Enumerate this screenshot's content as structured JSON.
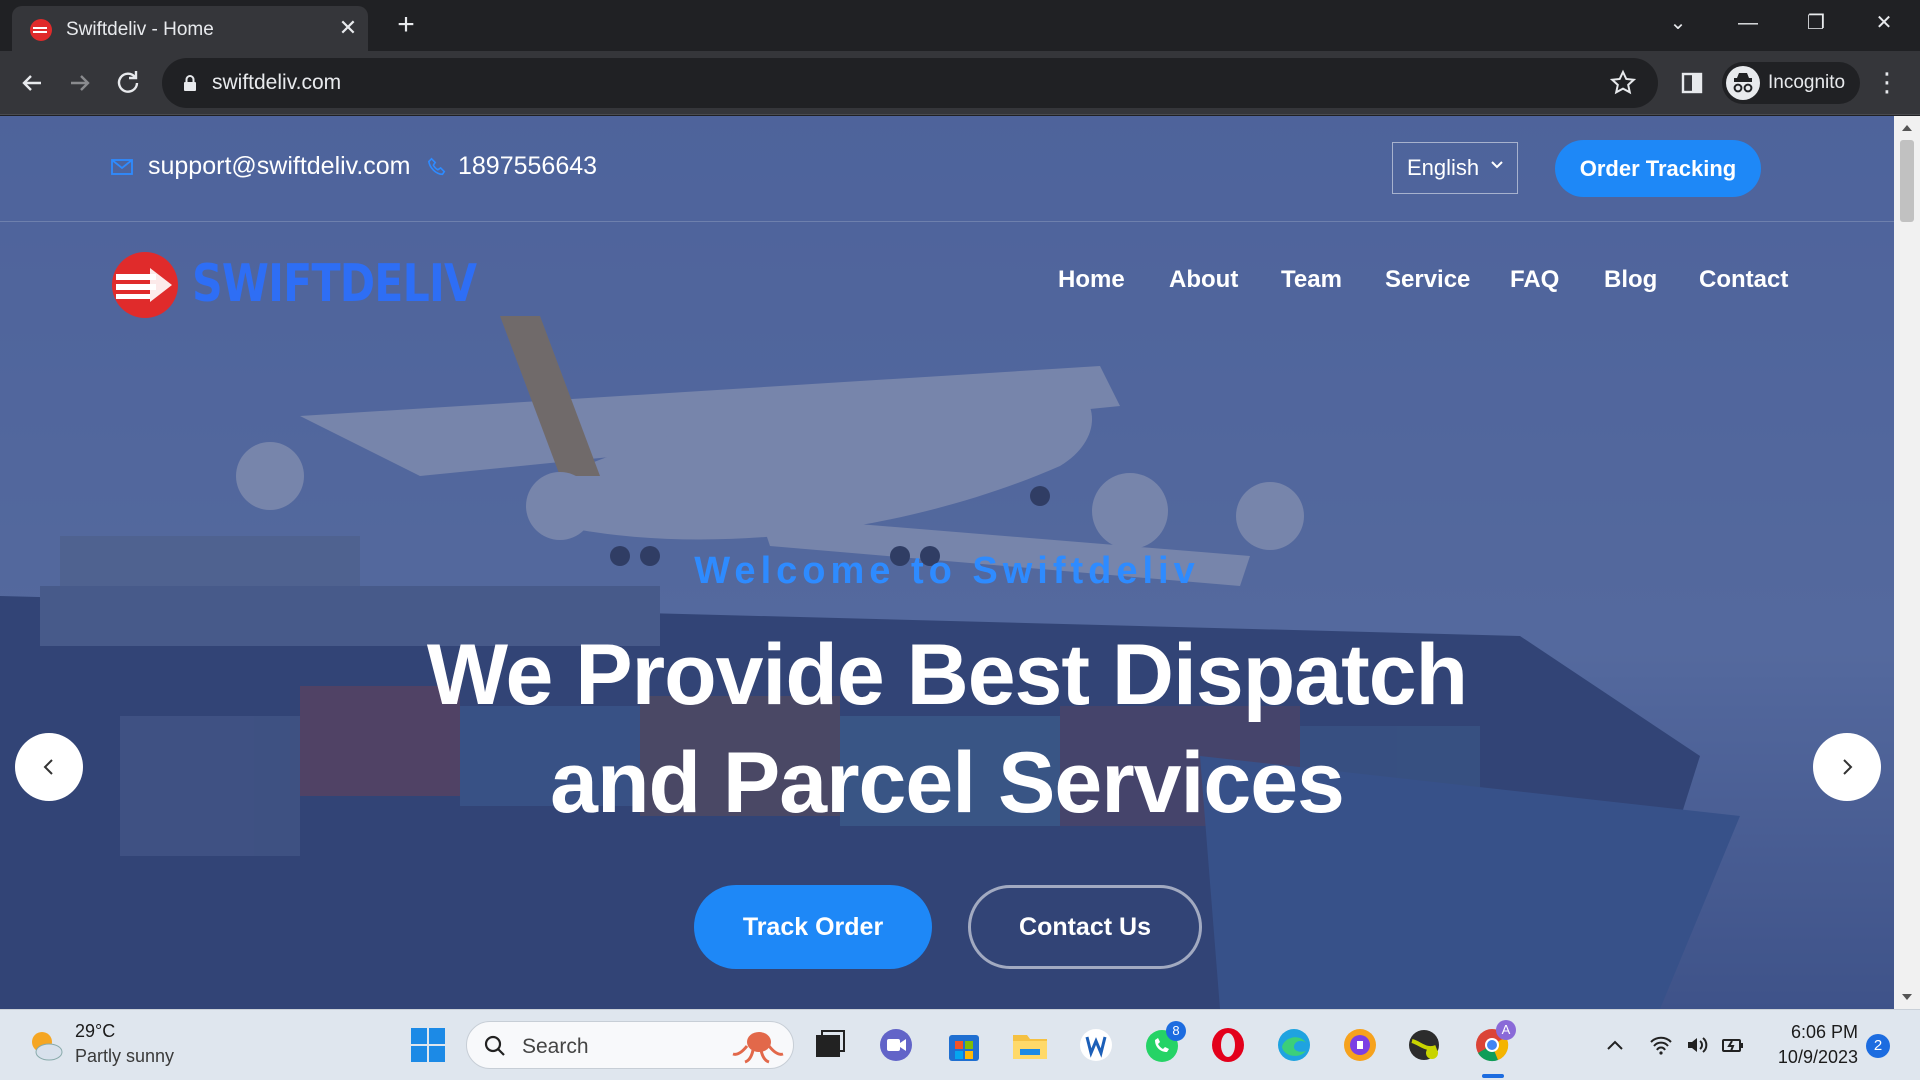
{
  "browser": {
    "tab_title": "Swiftdeliv - Home",
    "url": "swiftdeliv.com",
    "profile_label": "Incognito"
  },
  "site": {
    "email": "support@swiftdeliv.com",
    "phone": "1897556643",
    "language": "English",
    "order_tracking_label": "Order Tracking",
    "logo_text": "SWIFTDELIV",
    "nav": [
      "Home",
      "About",
      "Team",
      "Service",
      "FAQ",
      "Blog",
      "Contact"
    ],
    "hero": {
      "welcome": "Welcome to Swiftdeliv",
      "headline_line1": "We Provide Best Dispatch",
      "headline_line2": "and Parcel Services",
      "primary_button": "Track Order",
      "secondary_button": "Contact Us"
    },
    "colors": {
      "accent": "#1e88f7",
      "logo": "#2e6ef5",
      "logo_mark": "#e02b2b"
    }
  },
  "taskbar": {
    "weather_temp": "29°C",
    "weather_desc": "Partly sunny",
    "search_label": "Search",
    "whatsapp_badge": "8",
    "chrome_profile_badge": "A",
    "time": "6:06 PM",
    "date": "10/9/2023",
    "notifications": "2"
  }
}
